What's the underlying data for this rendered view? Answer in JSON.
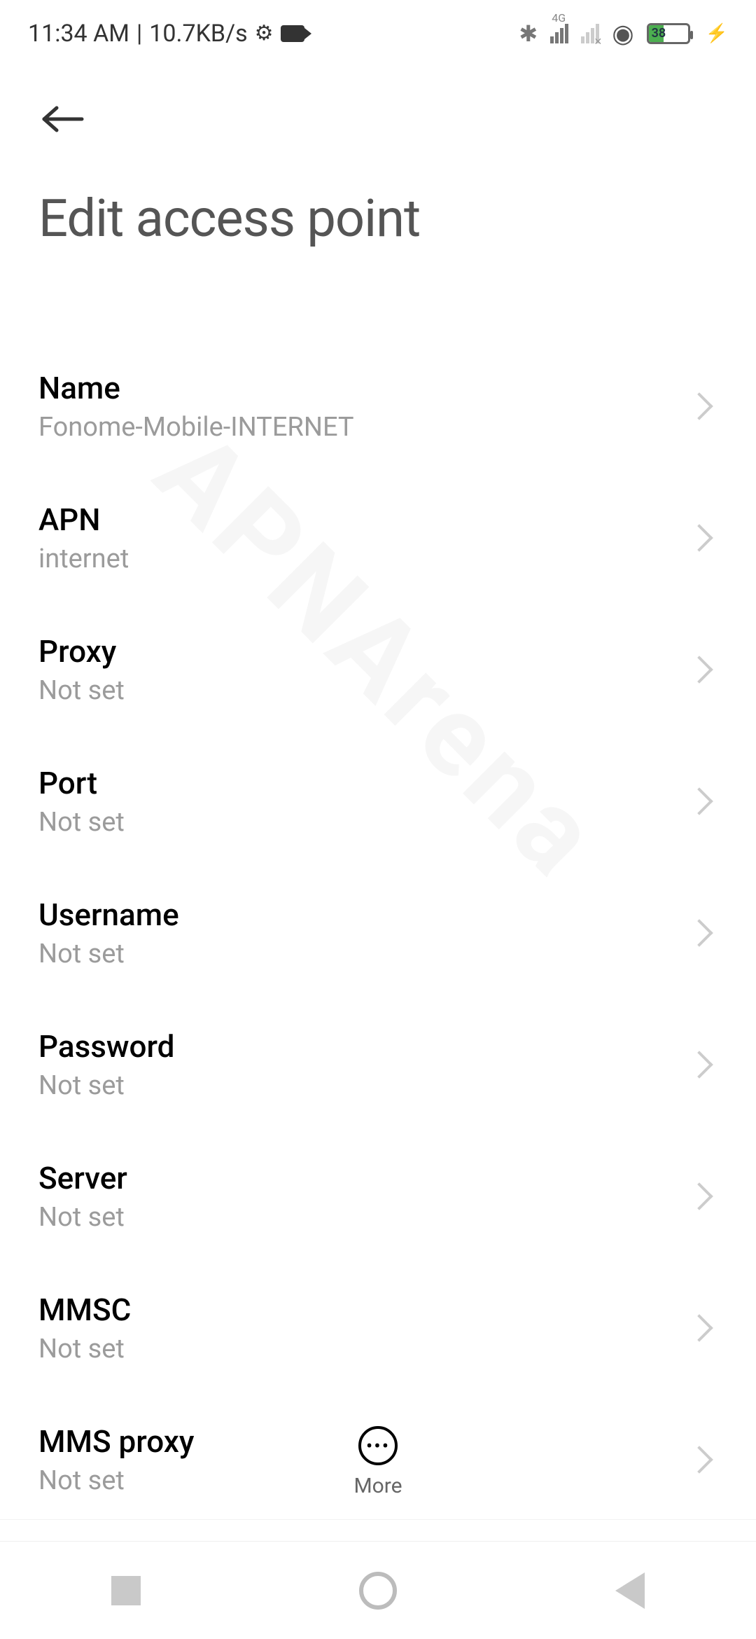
{
  "status_bar": {
    "time": "11:34 AM",
    "network_speed": "10.7KB/s",
    "signal_label": "4G",
    "battery_percent": "38"
  },
  "header": {
    "title": "Edit access point"
  },
  "settings": [
    {
      "label": "Name",
      "value": "Fonome-Mobile-INTERNET"
    },
    {
      "label": "APN",
      "value": "internet"
    },
    {
      "label": "Proxy",
      "value": "Not set"
    },
    {
      "label": "Port",
      "value": "Not set"
    },
    {
      "label": "Username",
      "value": "Not set"
    },
    {
      "label": "Password",
      "value": "Not set"
    },
    {
      "label": "Server",
      "value": "Not set"
    },
    {
      "label": "MMSC",
      "value": "Not set"
    },
    {
      "label": "MMS proxy",
      "value": "Not set"
    }
  ],
  "bottom": {
    "more_label": "More"
  },
  "watermark": "APNArena"
}
